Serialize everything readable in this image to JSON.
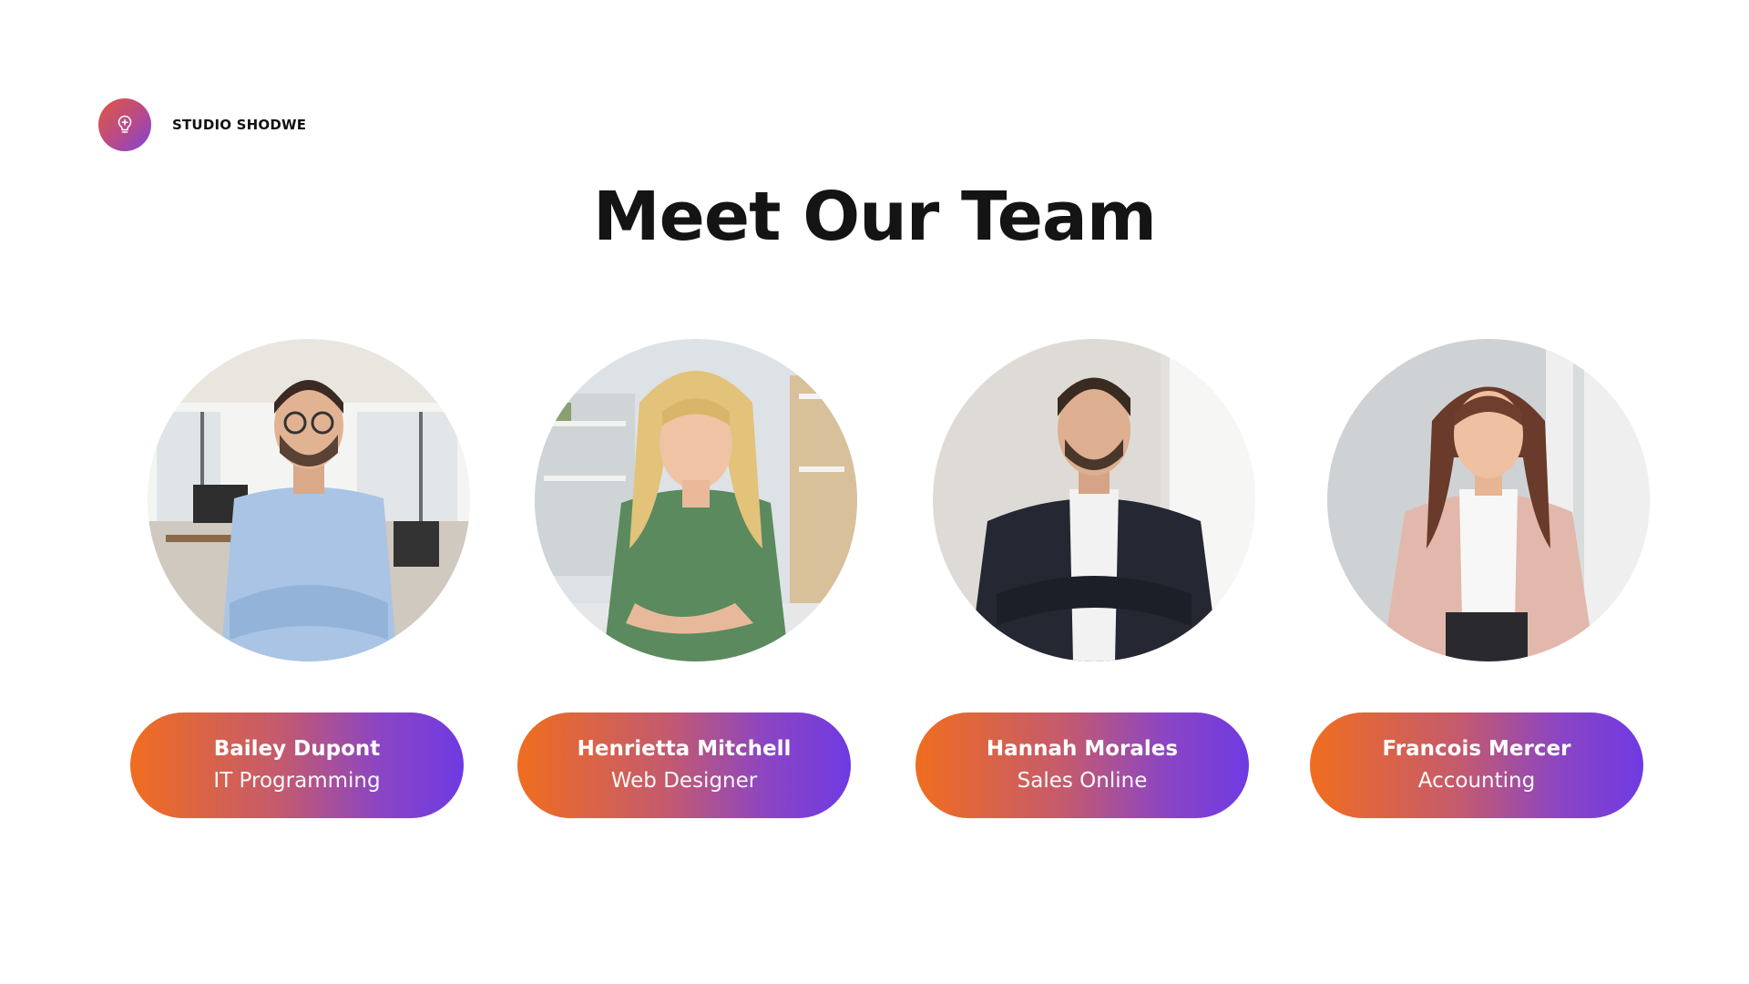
{
  "brand": {
    "name": "STUDIO SHODWE",
    "icon": "lightbulb-icon"
  },
  "title": "Meet Our Team",
  "colors": {
    "gradient_start": "#f06d1f",
    "gradient_end": "#6f3ae3",
    "title": "#141414",
    "background": "#ffffff"
  },
  "members": [
    {
      "name": "Bailey Dupont",
      "role": "IT Programming",
      "photo": "man-blue-shirt-office-photo"
    },
    {
      "name": "Henrietta Mitchell",
      "role": "Web Designer",
      "photo": "woman-green-top-desk-photo"
    },
    {
      "name": "Hannah Morales",
      "role": "Sales Online",
      "photo": "man-dark-suit-photo"
    },
    {
      "name": "Francois Mercer",
      "role": "Accounting",
      "photo": "woman-pink-blazer-photo"
    }
  ]
}
